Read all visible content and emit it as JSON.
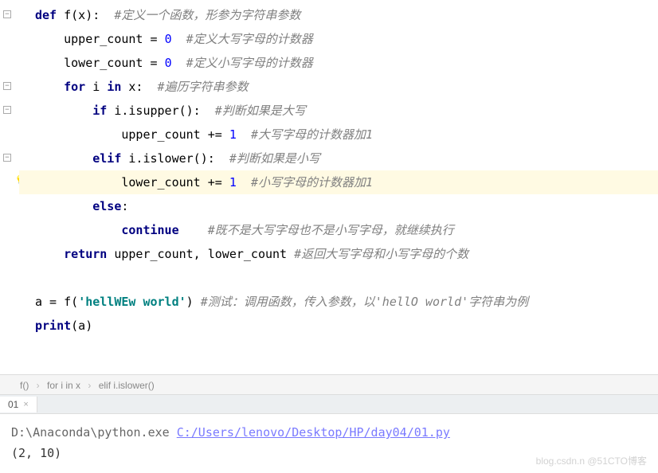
{
  "code": {
    "lines": [
      {
        "indent": 0,
        "tokens": [
          {
            "t": "def ",
            "c": "kw"
          },
          {
            "t": "f(x):  ",
            "c": "fn"
          },
          {
            "t": "#定义一个函数，形参为字符串参数",
            "c": "cmt"
          }
        ],
        "fold": "minus"
      },
      {
        "indent": 1,
        "tokens": [
          {
            "t": "upper_count = ",
            "c": "fn"
          },
          {
            "t": "0",
            "c": "num"
          },
          {
            "t": "  ",
            "c": "fn"
          },
          {
            "t": "#定义大写字母的计数器",
            "c": "cmt"
          }
        ]
      },
      {
        "indent": 1,
        "tokens": [
          {
            "t": "lower_count = ",
            "c": "fn"
          },
          {
            "t": "0",
            "c": "num"
          },
          {
            "t": "  ",
            "c": "fn"
          },
          {
            "t": "#定义小写字母的计数器",
            "c": "cmt"
          }
        ]
      },
      {
        "indent": 1,
        "tokens": [
          {
            "t": "for ",
            "c": "kw"
          },
          {
            "t": "i ",
            "c": "fn"
          },
          {
            "t": "in ",
            "c": "kw"
          },
          {
            "t": "x:  ",
            "c": "fn"
          },
          {
            "t": "#遍历字符串参数",
            "c": "cmt"
          }
        ],
        "fold": "minus"
      },
      {
        "indent": 2,
        "tokens": [
          {
            "t": "if ",
            "c": "kw"
          },
          {
            "t": "i.isupper():  ",
            "c": "fn"
          },
          {
            "t": "#判断如果是大写",
            "c": "cmt"
          }
        ],
        "fold": "minus"
      },
      {
        "indent": 3,
        "tokens": [
          {
            "t": "upper_count += ",
            "c": "fn"
          },
          {
            "t": "1",
            "c": "num"
          },
          {
            "t": "  ",
            "c": "fn"
          },
          {
            "t": "#大写字母的计数器加1",
            "c": "cmt"
          }
        ]
      },
      {
        "indent": 2,
        "tokens": [
          {
            "t": "elif ",
            "c": "kw"
          },
          {
            "t": "i.islower():  ",
            "c": "fn"
          },
          {
            "t": "#判断如果是小写",
            "c": "cmt"
          }
        ],
        "fold": "minus"
      },
      {
        "indent": 3,
        "highlighted": true,
        "bulb": true,
        "tokens": [
          {
            "t": "lower_count += ",
            "c": "fn"
          },
          {
            "t": "1",
            "c": "num"
          },
          {
            "t": "  ",
            "c": "fn"
          },
          {
            "t": "#小写字母的计数器加1",
            "c": "cmt"
          }
        ]
      },
      {
        "indent": 2,
        "tokens": [
          {
            "t": "else",
            "c": "kw"
          },
          {
            "t": ":",
            "c": "fn"
          }
        ]
      },
      {
        "indent": 3,
        "tokens": [
          {
            "t": "continue",
            "c": "kw"
          },
          {
            "t": "    ",
            "c": "fn"
          },
          {
            "t": "#既不是大写字母也不是小写字母，就继续执行",
            "c": "cmt"
          }
        ],
        "fold": "end"
      },
      {
        "indent": 1,
        "tokens": [
          {
            "t": "return ",
            "c": "kw"
          },
          {
            "t": "upper_count, lower_count ",
            "c": "fn"
          },
          {
            "t": "#返回大写字母和小写字母的个数",
            "c": "cmt"
          }
        ],
        "fold": "end"
      },
      {
        "indent": 0,
        "tokens": []
      },
      {
        "indent": 0,
        "tokens": [
          {
            "t": "a = f(",
            "c": "fn"
          },
          {
            "t": "'hellWEw world'",
            "c": "str"
          },
          {
            "t": ") ",
            "c": "fn"
          },
          {
            "t": "#测试：调用函数，传入参数，以'hellO world'字符串为例",
            "c": "cmt"
          }
        ]
      },
      {
        "indent": 0,
        "tokens": [
          {
            "t": "print",
            "c": "kw"
          },
          {
            "t": "(a)",
            "c": "fn"
          }
        ]
      },
      {
        "indent": 0,
        "tokens": []
      }
    ]
  },
  "breadcrumb": {
    "items": [
      "f()",
      "for i in x",
      "elif i.islower()"
    ]
  },
  "tabbar": {
    "tab_label": "01",
    "tab_close": "×"
  },
  "console": {
    "exe_path": "D:\\Anaconda\\python.exe ",
    "script_path": "C:/Users/lenovo/Desktop/HP/day04/01.py",
    "output": "(2, 10)"
  },
  "watermark": "blog.csdn.n @51CTO博客"
}
